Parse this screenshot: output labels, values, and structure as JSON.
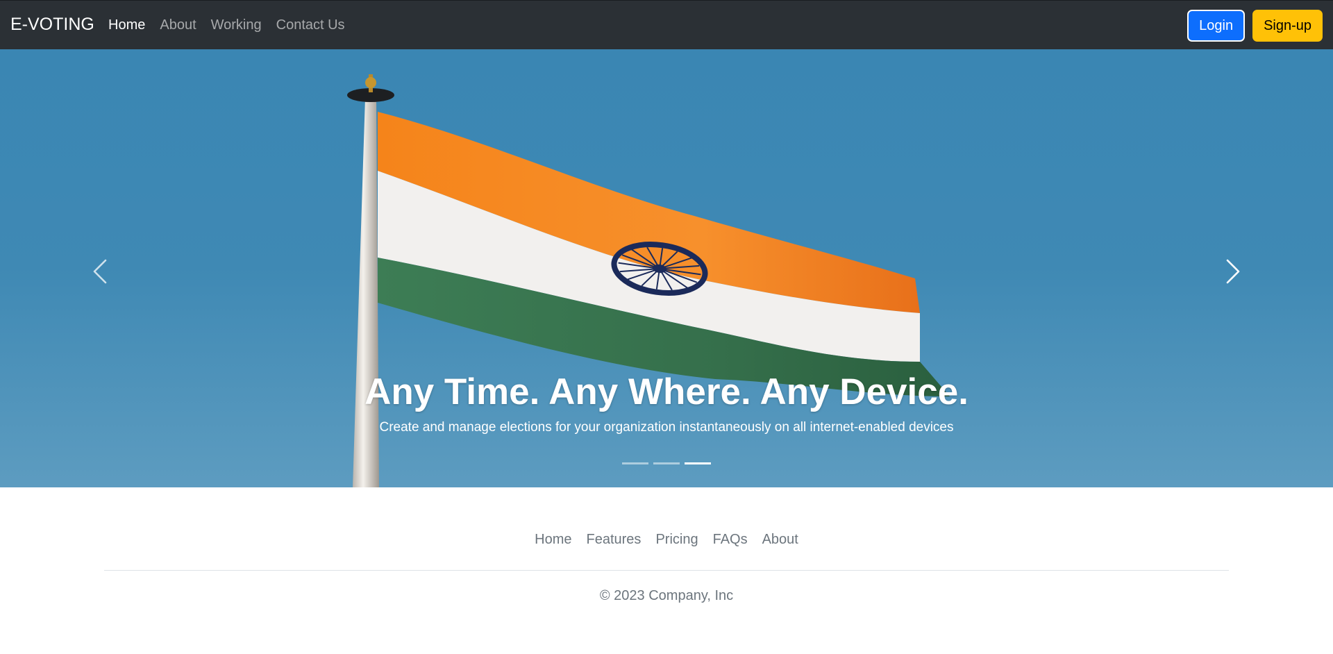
{
  "navbar": {
    "brand": "E-VOTING",
    "links": [
      "Home",
      "About",
      "Working",
      "Contact Us"
    ],
    "active_link": "Home",
    "login_label": "Login",
    "signup_label": "Sign-up"
  },
  "hero": {
    "title": "Any Time. Any Where. Any Device.",
    "subtitle": "Create and manage elections for your organization instantaneously on all internet-enabled devices",
    "slide_count": 3,
    "active_slide": 3,
    "prev_icon": "chevron-left-icon",
    "next_icon": "chevron-right-icon"
  },
  "footer": {
    "links": [
      "Home",
      "Features",
      "Pricing",
      "FAQs",
      "About"
    ],
    "copyright": "© 2023 Company, Inc"
  },
  "colors": {
    "navbar_bg": "#2b3035",
    "login_bg": "#0d6efd",
    "signup_bg": "#ffc107",
    "sky": "#3f89b4",
    "saffron": "#f7861e",
    "green": "#3a7a52",
    "chakra": "#1b2a5a"
  }
}
